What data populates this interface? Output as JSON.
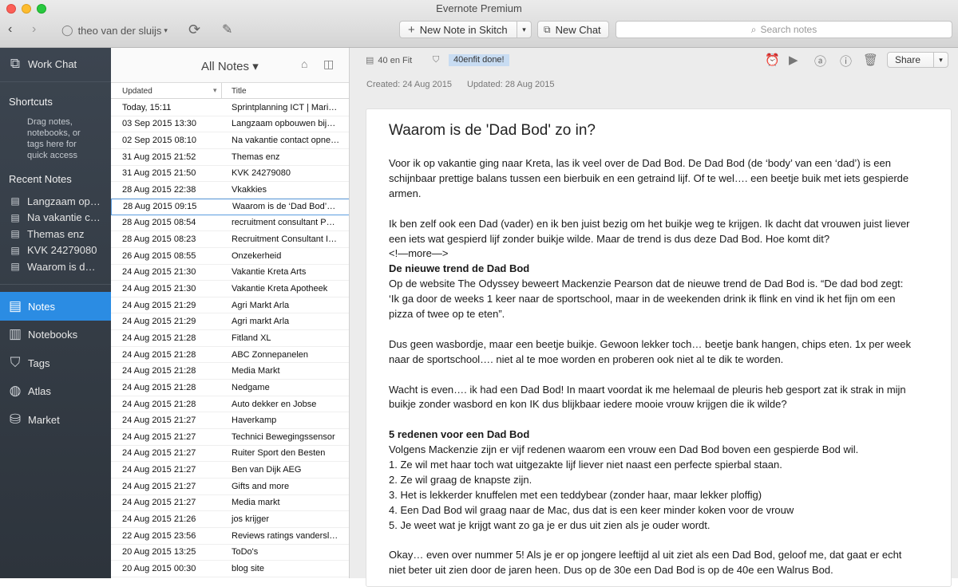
{
  "window": {
    "title": "Evernote Premium"
  },
  "toolbar": {
    "user": "theo van der sluijs",
    "new_note_label": "New Note in Skitch",
    "new_chat_label": "New Chat",
    "search_placeholder": "Search notes"
  },
  "sidebar": {
    "work_chat": "Work Chat",
    "shortcuts_heading": "Shortcuts",
    "shortcuts_hint": [
      "Drag notes,",
      "notebooks, or",
      "tags here for",
      "quick access"
    ],
    "recent_heading": "Recent Notes",
    "recent": [
      "Langzaam op…",
      "Na vakantie c…",
      "Themas enz",
      "KVK 24279080",
      "Waarom is d…"
    ],
    "nav": [
      "Notes",
      "Notebooks",
      "Tags",
      "Atlas",
      "Market"
    ]
  },
  "notelist": {
    "title": "All Notes ▾",
    "col_updated": "Updated",
    "col_title": "Title",
    "rows": [
      {
        "date": "Today, 15:11",
        "title": "Sprintplanning ICT | Marius…"
      },
      {
        "date": "03 Sep 2015 13:30",
        "title": "Langzaam opbouwen bij…"
      },
      {
        "date": "02 Sep 2015 08:10",
        "title": "Na vakantie contact opne…"
      },
      {
        "date": "31 Aug 2015 21:52",
        "title": "Themas enz"
      },
      {
        "date": "31 Aug 2015 21:50",
        "title": "KVK 24279080"
      },
      {
        "date": "28 Aug 2015 22:38",
        "title": "Vkakkies"
      },
      {
        "date": "28 Aug 2015 09:15",
        "title": "Waarom is de ‘Dad Bod’…"
      },
      {
        "date": "28 Aug 2015 08:54",
        "title": "recruitment consultant P…"
      },
      {
        "date": "28 Aug 2015 08:23",
        "title": "Recruitment Consultant I…"
      },
      {
        "date": "26 Aug 2015 08:55",
        "title": "Onzekerheid"
      },
      {
        "date": "24 Aug 2015 21:30",
        "title": "Vakantie Kreta Arts"
      },
      {
        "date": "24 Aug 2015 21:30",
        "title": "Vakantie Kreta Apotheek"
      },
      {
        "date": "24 Aug 2015 21:29",
        "title": "Agri Markt Arla"
      },
      {
        "date": "24 Aug 2015 21:29",
        "title": "Agri markt Arla"
      },
      {
        "date": "24 Aug 2015 21:28",
        "title": "Fitland XL"
      },
      {
        "date": "24 Aug 2015 21:28",
        "title": "ABC Zonnepanelen"
      },
      {
        "date": "24 Aug 2015 21:28",
        "title": "Media Markt"
      },
      {
        "date": "24 Aug 2015 21:28",
        "title": "Nedgame"
      },
      {
        "date": "24 Aug 2015 21:28",
        "title": "Auto dekker en Jobse"
      },
      {
        "date": "24 Aug 2015 21:27",
        "title": "Haverkamp"
      },
      {
        "date": "24 Aug 2015 21:27",
        "title": "Technici Bewegingssensor"
      },
      {
        "date": "24 Aug 2015 21:27",
        "title": "Ruiter Sport den Besten"
      },
      {
        "date": "24 Aug 2015 21:27",
        "title": "Ben van Dijk AEG"
      },
      {
        "date": "24 Aug 2015 21:27",
        "title": "Gifts and more"
      },
      {
        "date": "24 Aug 2015 21:27",
        "title": "Media markt"
      },
      {
        "date": "24 Aug 2015 21:26",
        "title": "jos krijger"
      },
      {
        "date": "22 Aug 2015 23:56",
        "title": "Reviews ratings vandersluijs"
      },
      {
        "date": "20 Aug 2015 13:25",
        "title": "ToDo's"
      },
      {
        "date": "20 Aug 2015 00:30",
        "title": "blog site"
      }
    ],
    "selected_index": 6
  },
  "note": {
    "notebook": "40 en Fit",
    "tag": "40enfit done!",
    "created": "Created: 24 Aug 2015",
    "updated": "Updated: 28 Aug 2015",
    "share_label": "Share",
    "title": "Waarom is de 'Dad Bod' zo in?",
    "p1": [
      "Voor ik op vakantie ging naar Kreta, las ik veel over de Dad Bod. De Dad Bod (de ‘body’ van een ‘dad’) is een",
      "schijnbaar prettige balans tussen een bierbuik en een getraind lijf. Of te wel…. een beetje buik met iets gespierde",
      "armen."
    ],
    "p2": [
      "Ik ben zelf ook een Dad (vader) en ik ben juist bezig om het buikje weg te krijgen. Ik dacht dat vrouwen juist liever",
      "een iets wat gespierd lijf zonder buikje wilde. Maar de trend is dus deze Dad Bod. Hoe komt dit?",
      "<!—more—>"
    ],
    "h1": "De nieuwe trend de Dad Bod",
    "p3": [
      "Op de website The Odyssey beweert Mackenzie Pearson dat de nieuwe trend de Dad Bod is. “De dad bod zegt:",
      "‘Ik ga door de weeks 1 keer naar de sportschool, maar in de weekenden drink ik flink en vind ik het fijn om een",
      "pizza of twee op te eten”."
    ],
    "p4": [
      "Dus geen wasbordje, maar een beetje buikje. Gewoon lekker toch… beetje bank hangen, chips eten. 1x per week",
      "naar de sportschool…. niet al te moe worden en proberen ook niet al te dik te worden."
    ],
    "p5": [
      "Wacht is even…. ik had een Dad Bod! In maart voordat ik me helemaal de pleuris heb gesport zat ik strak in mijn",
      "buikje zonder wasbord en kon IK dus blijkbaar iedere mooie vrouw krijgen die ik wilde?"
    ],
    "h2": "5 redenen voor een  Dad Bod",
    "p6": [
      "Volgens Mackenzie zijn er vijf redenen waarom een vrouw een Dad Bod boven een gespierde Bod wil.",
      "1. Ze wil met haar toch wat uitgezakte lijf liever niet naast een perfecte spierbal staan.",
      "2. Ze wil graag de knapste zijn.",
      "3. Het is lekkerder knuffelen met een teddybear (zonder haar, maar lekker ploffig)",
      "4. Een Dad Bod wil graag naar de Mac, dus dat is een keer minder koken voor de vrouw",
      "5. Je weet wat je krijgt want zo ga je er dus uit zien als je ouder wordt."
    ],
    "p7": [
      "Okay… even over nummer 5! Als je er op jongere leeftijd al uit ziet als een Dad Bod, geloof me, dat gaat er echt",
      "niet beter uit zien door de jaren heen. Dus op de 30e een Dad Bod is op de 40e een Walrus Bod."
    ]
  }
}
